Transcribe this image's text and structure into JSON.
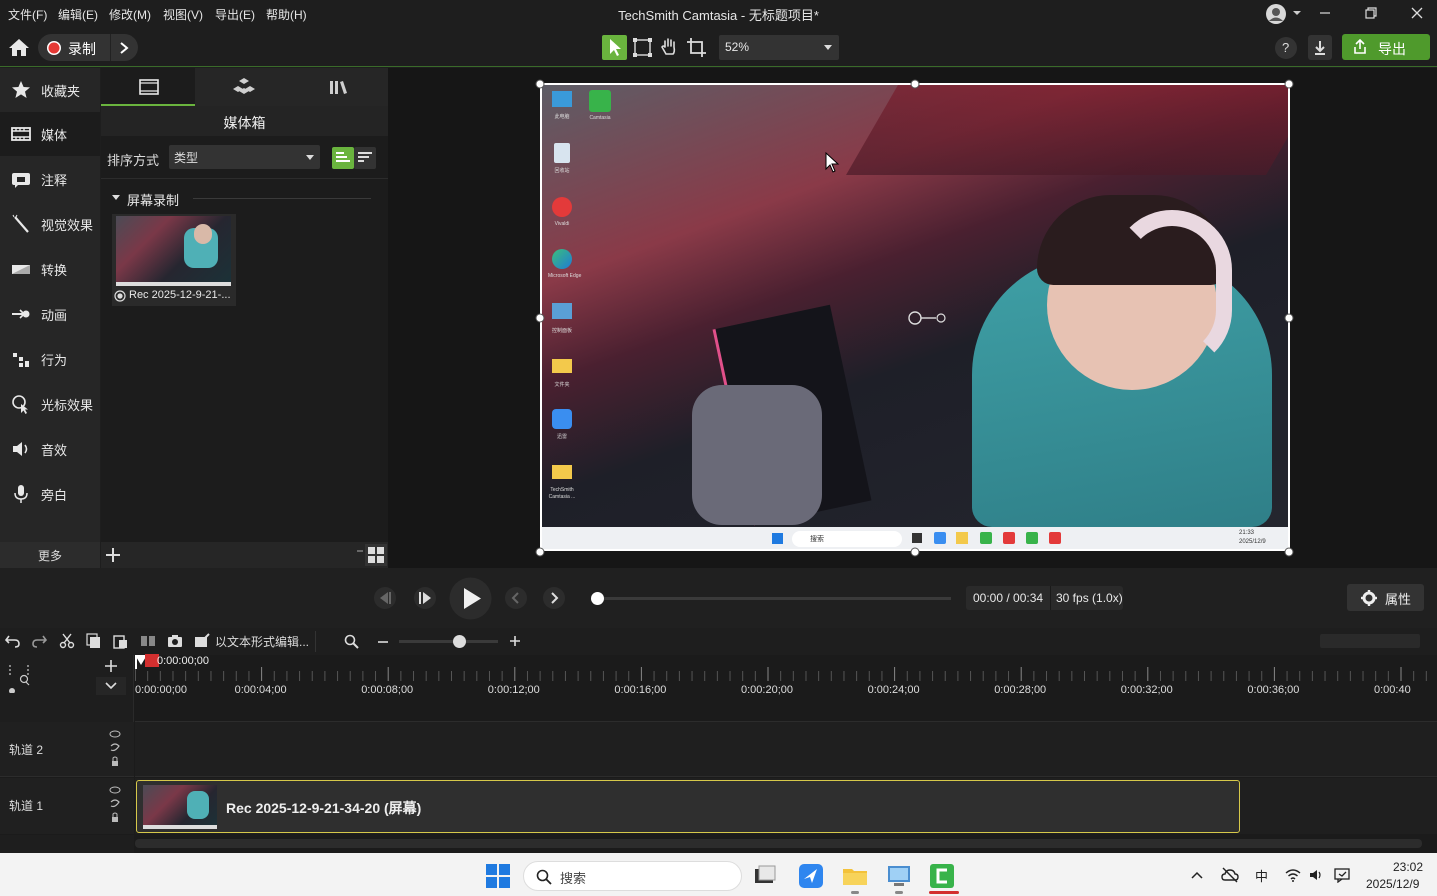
{
  "menu": [
    "文件(F)",
    "编辑(E)",
    "修改(M)",
    "视图(V)",
    "导出(E)",
    "帮助(H)"
  ],
  "app_title": "TechSmith Camtasia - 无标题项目*",
  "toolbar": {
    "record_label": "录制",
    "zoom": "52%",
    "export_label": "导出",
    "help": "?"
  },
  "rail": [
    {
      "label": "收藏夹",
      "icon": "star-icon"
    },
    {
      "label": "媒体",
      "icon": "film-icon"
    },
    {
      "label": "注释",
      "icon": "annotation-icon"
    },
    {
      "label": "视觉效果",
      "icon": "wand-icon"
    },
    {
      "label": "转换",
      "icon": "transition-icon"
    },
    {
      "label": "动画",
      "icon": "animation-icon"
    },
    {
      "label": "行为",
      "icon": "behavior-icon"
    },
    {
      "label": "光标效果",
      "icon": "cursor-effect-icon"
    },
    {
      "label": "音效",
      "icon": "speaker-icon"
    },
    {
      "label": "旁白",
      "icon": "microphone-icon"
    }
  ],
  "rail_more": "更多",
  "bin": {
    "title": "媒体箱",
    "sort_label": "排序方式",
    "sort_value": "类型",
    "group": "屏幕录制",
    "clip_name": "Rec 2025-12-9-21-..."
  },
  "desktop_icons": [
    "此电脑",
    "Camtasia",
    "回收站",
    "Vivaldi",
    "Microsoft Edge",
    "控制面板",
    "文件夹",
    "迅雷",
    "TechSmith Camtasia ..."
  ],
  "inner_taskbar": {
    "search": "搜索",
    "time": "21:33",
    "date": "2025/12/9"
  },
  "playback": {
    "time": "00:00 / 00:34",
    "fps": "30 fps (1.0x)",
    "properties": "属性",
    "progress": 0.0
  },
  "tltools": {
    "text_edit": "以文本形式编辑..."
  },
  "timeline": {
    "playhead": "0:00:00;00",
    "ticks": [
      "0:00:00;00",
      "0:00:04;00",
      "0:00:08;00",
      "0:00:12;00",
      "0:00:16;00",
      "0:00:20;00",
      "0:00:24;00",
      "0:00:28;00",
      "0:00:32;00",
      "0:00:36;00",
      "0:00:40"
    ],
    "tracks": [
      {
        "name": "轨道 2"
      },
      {
        "name": "轨道 1"
      }
    ],
    "clip_title": "Rec 2025-12-9-21-34-20 (屏幕)"
  },
  "taskbar": {
    "search": "搜索",
    "ime": "中",
    "time": "23:02",
    "date": "2025/12/9"
  },
  "colors": {
    "accent": "#6ab43e",
    "clip_border": "#d6c84a",
    "record": "#e53935",
    "bg": "#1e1e1e"
  }
}
